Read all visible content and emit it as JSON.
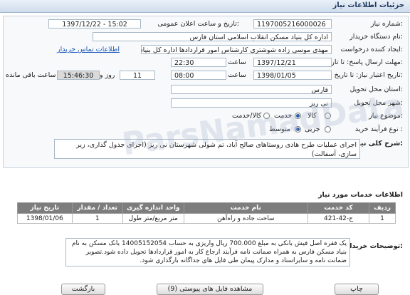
{
  "window": {
    "title": "جزئیات اطلاعات نیاز"
  },
  "fields": {
    "need_number_label": "شماره نیاز:",
    "need_number": "1197005216000026",
    "announce_label": "تاریخ و ساعت اعلان عمومی:",
    "announce_value": "1397/12/22 - 15:02",
    "buyer_label": "نام دستگاه خریدار:",
    "buyer_value": "اداره کل بنیاد مسکن انقلاب اسلامی استان فارس",
    "creator_label": "ایجاد کننده درخواست:",
    "creator_value": "مهدی موسی زاده شوشتری کارشناس امور قراردادها اداره کل بنیاد مسکن انقلا",
    "contact_link": "اطلاعات تماس خریدار",
    "reply_deadline_label": "مهلت ارسال پاسخ: تا تاریخ:",
    "reply_date": "1397/12/21",
    "time_label": "ساعت",
    "reply_time": "22:30",
    "validity_label": "تاریخ اعتبار نیاز: تا تاریخ:",
    "validity_date": "1398/01/05",
    "validity_time": "08:00",
    "days_value": "11",
    "days_label": "روز و",
    "remaining_time": "15:46:30",
    "remaining_label": "ساعت باقی مانده",
    "province_label": "استان محل تحویل:",
    "province_value": "فارس",
    "city_label": "شهر محل تحویل:",
    "city_value": "نی ریز",
    "classification_label": "موضوع نیاز:",
    "class_goods": "کالا",
    "class_service": "خدمت",
    "class_goods_service": "کالا/خدمت",
    "process_label": "نوع فرآیند خرید :",
    "process_partial": "جزیی",
    "process_medium": "متوسط"
  },
  "description": {
    "label": "شرح کلی نیاز:",
    "text": "اجرای عملیات طرح هادی روستاهای صالح آباد، تم شولی شهرستان نی ریز (اجرای جدول گذاری، زیر سازی، آسفالت)"
  },
  "services": {
    "section_title": "اطلاعات خدمات مورد نیاز",
    "columns": [
      "ردیف",
      "کد خدمت",
      "نام خدمت",
      "واحد اندازه گیری",
      "تعداد / مقدار",
      "تاریخ نیاز"
    ],
    "rows": [
      [
        "1",
        "ج-42-421",
        "ساخت جاده و راه‌آهن",
        "متر مربع/متر طول",
        "1",
        "1398/01/06"
      ]
    ]
  },
  "buyer_notes": {
    "label": "توضیحات خریدار:",
    "text": "یک فقره اصل فیش بانکی به مبلغ 700.000 ریال واریزی به حساب 14005152054 بانک مسکن به نام بنیاد مسکن فارس به همراه ضمانت نامه فرآیند ارجاع کار به امور قراردادها تحویل داده شود.تصویر ضمانت نامه و سایراسناد و مدارک پیمان طی فایل های جداگانه بارگذاری شود."
  },
  "buttons": {
    "print": "چاپ",
    "attachments": "مشاهده فایل های پیوستی (9)",
    "back": "بازگشت"
  },
  "watermark": "ParsNamadData"
}
